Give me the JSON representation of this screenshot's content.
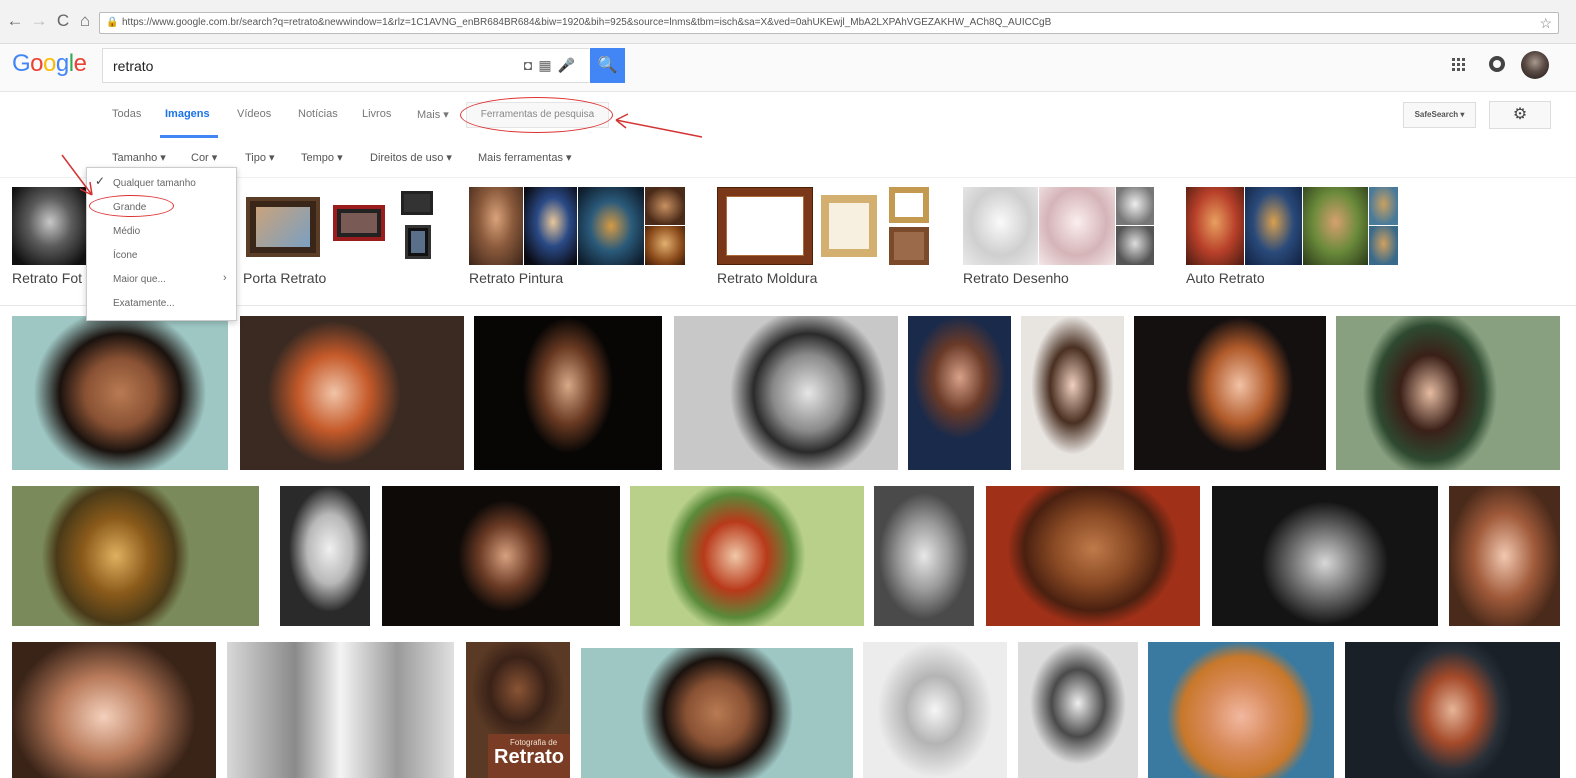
{
  "browser": {
    "url": "https://www.google.com.br/search?q=retrato&newwindow=1&rlz=1C1AVNG_enBR684BR684&biw=1920&bih=925&source=lnms&tbm=isch&sa=X&ved=0ahUKEwjl_MbA2LXPAhVGEZAKHW_ACh8Q_AUICCgB",
    "back_glyph": "←",
    "forward_glyph": "→",
    "reload_glyph": "C",
    "home_glyph": "⌂",
    "lock_glyph": "🔒",
    "star_glyph": "☆"
  },
  "header": {
    "logo_letters": [
      "G",
      "o",
      "o",
      "g",
      "l",
      "e"
    ],
    "logo_colors": [
      "#4285f4",
      "#ea4335",
      "#fbbc05",
      "#4285f4",
      "#34a853",
      "#ea4335"
    ],
    "query": "retrato",
    "search_glyph": "🔍",
    "apps_glyph": "⋮⋮⋮"
  },
  "tabs": {
    "items": [
      "Todas",
      "Imagens",
      "Vídeos",
      "Notícias",
      "Livros",
      "Mais ▾"
    ],
    "active": "Imagens",
    "tools_label": "Ferramentas de pesquisa",
    "safesearch_label": "SafeSearch ▾",
    "settings_glyph": "⚙"
  },
  "filters": [
    "Tamanho ▾",
    "Cor ▾",
    "Tipo ▾",
    "Tempo ▾",
    "Direitos de uso ▾",
    "Mais ferramentas ▾"
  ],
  "size_menu": {
    "checked_glyph": "✓",
    "items": [
      "Qualquer tamanho",
      "Grande",
      "Médio",
      "Ícone",
      "Maior que...",
      "Exatamente..."
    ],
    "submenu_glyph": "›"
  },
  "related": [
    "Retrato Fotografia",
    "Porta Retrato",
    "Retrato Pintura",
    "Retrato Moldura",
    "Retrato Desenho",
    "Auto Retrato"
  ],
  "visible_related_0": "Retrato Fot",
  "grid_text": {
    "book_cover_small": "Fotografia de",
    "book_cover_big": "Retrato"
  },
  "colors": {
    "accent": "#4285f4",
    "annotation": "#d33333"
  }
}
